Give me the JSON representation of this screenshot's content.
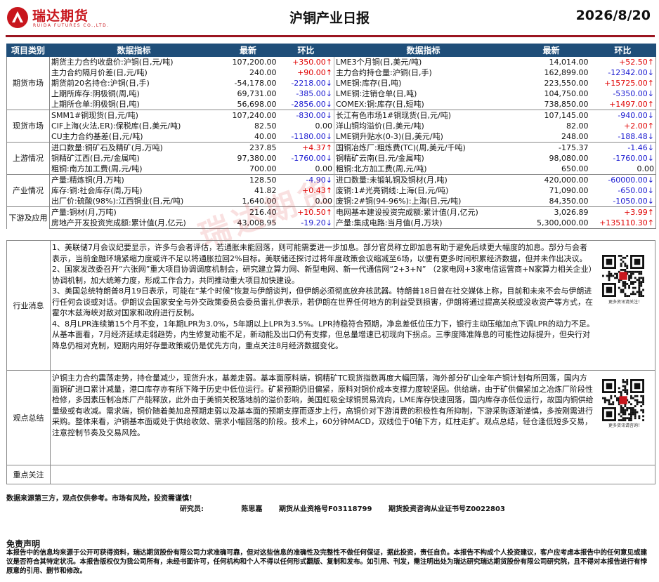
{
  "header": {
    "logo_cn": "瑞达期货",
    "logo_en": "RUIDA FUTURES CO.,LTD.",
    "title": "沪铜产业日报",
    "date": "2026/8/20"
  },
  "table": {
    "headers": [
      "项目类别",
      "数据指标",
      "最新",
      "环比",
      "数据指标",
      "最新",
      "环比"
    ],
    "groups": [
      {
        "name": "期货市场",
        "rows": [
          [
            "期货主力合约收盘价:沪铜(日,元/吨)",
            "107,200.00",
            "+350.00↑",
            "LME3个月铜(日,美元/吨)",
            "14,014.00",
            "+52.50↑"
          ],
          [
            "主力合约隔月价差(日,元/吨)",
            "240.00",
            "+90.00↑",
            " 主力合约持仓量:沪铜(日,手)",
            "162,899.00",
            "-12342.00↓"
          ],
          [
            "期货前20名持仓:沪铜(日,手)",
            "-54,178.00",
            "-2218.00↓",
            "LME铜:库存(日,吨)",
            "223,550.00",
            "+15725.00↑"
          ],
          [
            "上期所库存:阴极铜(周,吨)",
            "69,731.00",
            "-385.00↓",
            "LME铜:注销仓单(日,吨)",
            "104,750.00",
            "-5350.00↓"
          ],
          [
            "上期所仓单:阴极铜(日,吨)",
            "56,698.00",
            "-2856.00↓",
            "COMEX:铜:库存(日,短吨)",
            "738,850.00",
            "+1497.00↑"
          ]
        ]
      },
      {
        "name": "现货市场",
        "rows": [
          [
            "SMM1#铜现货(日,元/吨)",
            "107,240.00",
            "-830.00↓",
            "长江有色市场1#铜现货(日,元/吨)",
            "107,145.00",
            "-940.00↓"
          ],
          [
            "CIF上海(火法,ER):保税库(日,美元/吨)",
            "82.50",
            "0.00",
            "洋山铜均溢价(日,美元/吨)",
            "82.00",
            "+2.00↑"
          ],
          [
            "CU主力合约基差(日,元/吨)",
            "40.00",
            "-1180.00↓",
            "LME铜升贴水(0-3)(日,美元/吨)",
            "248.00",
            "-188.48↓"
          ]
        ]
      },
      {
        "name": "上游情况",
        "rows": [
          [
            "进口数量:铜矿石及精矿(月,万吨)",
            "237.85",
            "+4.37↑",
            "国铜冶炼厂:粗炼费(TC)(周,美元/千吨)",
            "-175.37",
            "-1.46↓"
          ],
          [
            "铜精矿江西(日,元/金属吨)",
            "97,380.00",
            "-1760.00↓",
            "铜精矿云南(日,元/金属吨)",
            "98,080.00",
            "-1760.00↓"
          ],
          [
            "粗铜:南方加工费(周,元/吨)",
            "700.00",
            "0.00",
            "粗铜:北方加工费(周,元/吨)",
            "650.00",
            "0.00"
          ]
        ]
      },
      {
        "name": "产业情况",
        "rows": [
          [
            "产量:精炼铜(月,万吨)",
            "128.50",
            "-4.90↓",
            "进口数量:未锻轧铜及铜材(月,吨)",
            "420,000.00",
            "-60000.00↓"
          ],
          [
            "库存:铜:社会库存(周,万吨)",
            "41.82",
            "+0.43↑",
            "废铜:1#光亮铜线:上海(日,元/吨)",
            "71,090.00",
            "-650.00↓"
          ],
          [
            "出厂价:硫酸(98%):江西铜业(日,元/吨)",
            "1,640.00",
            "0.00",
            "废铜:2#铜(94-96%):上海(日,元/吨)",
            "84,350.00",
            "-1050.00↓"
          ]
        ]
      },
      {
        "name": "下游及应用",
        "rows": [
          [
            "产量:铜材(月,万吨)",
            "216.40",
            "+10.50↑",
            "电网基本建设投资完成额:累计值(月,亿元)",
            "3,026.89",
            "+3.99↑"
          ],
          [
            "房地产开发投资完成额:累计值(月,亿元)",
            "43,008.95",
            "-19.20↓",
            "产量:集成电路:当月值(月,万块)",
            "5,300,000.00",
            "+135110.30↑"
          ]
        ]
      }
    ]
  },
  "news": {
    "label": "行业消息",
    "items": [
      "1、美联储7月会议纪要显示，许多与会者评估，若通胀未能回落，则可能需要进一步加息。部分官员称立即加息有助于避免后续更大幅度的加息。部分与会者表示，当前金融环境紧缩力度或许不足以将通胀拉回2%目标。美联储还探讨过将年度政策会议缩减至6场，以便有更多时间积累经济数据，但并未作出决议。",
      "2、国家发改委召开“六张网”重大项目协调调度机制会，研究建立算力网、新型电网、新一代通信网“2+3+N” （2家电网+3家电信运营商+N家算力相关企业）协调机制，加大统筹力度，形成工作合力，共同推动重大项目加快建设。",
      "3、美国总统特朗普8月19日表示，可能在“某个时候”恢复与伊朗谈判，但伊朗必须彻底放弃核武器。特朗普18日曾在社交媒体上称，目前和未来不会与伊朗进行任何会谈或对话。伊朗议会国家安全与外交政策委员会委员雷扎伊表示，若伊朗在世界任何地方的利益受到损害，伊朗将通过提高关税或没收资产等方式，在霍尔木兹海峡对敌对国家和政府进行反制。",
      "4、8月LPR连续第15个月不变，1年期LPR为3.0%，5年期以上LPR为3.5%。LPR持稳符合预期，净息差低位压力下，银行主动压缩加点下调LPR的动力不足。从基本面看，7月经济延续走弱趋势，内生修复动能不足，新动能及出口仍有支撑，但总量增速已初现向下拐点。三季度降准降息的可能性边际提升，但央行对降息仍相对克制，短期内用好存量政策或仍是优先方向，重点关注8月经济数据变化。"
    ],
    "qr_caption": "更多资讯请关注！"
  },
  "view": {
    "label": "观点总结",
    "text": "沪铜主力合约震荡走势，持仓量减少，现货升水，基差走弱。基本面原料端，铜精矿TC现货指数再度大幅回落，海外部分矿山全年产铜计划有所回落，国内方面铜矿进口累计减量，港口库存亦有所下降于历史中低位运行。矿紧预期仍旧偏紧，原料对铜价成本支撑力度较坚固。供给端，由于矿供偏紧加之冶炼厂阶段性检修，多因素压制冶炼厂产能释放，此外由于美铜关税落地前的溢价影响，美国虹吸全球铜贸易流向，LME库存快速回落，国内库存亦低位运行，故国内铜供给量级或有收减。需求端，铜价随着美加息预期走弱以及基本面的预期支撑而逐步上行，高铜价对下游消费的积极性有所抑制，下游采购逐渐谨慎，多按刚需进行采购。整体来看，沪铜基本面或处于供给收敛、需求小幅回落的阶段。技术上，60分钟MACD，双线位于0轴下方，红柱走扩。观点总结，轻仓逢低短多交易，注意控制节奏及交易风险。",
    "qr_caption": "更多资讯请咨询！"
  },
  "focus": {
    "label": "重点关注",
    "text": ""
  },
  "footer": {
    "source": "数据来源第三方，观点仅供参考。市场有风险，投资需谨慎！",
    "researcher_label": "研究员:",
    "researcher_name": "陈思嘉",
    "cert1": "期货从业资格号F03118799",
    "cert2": "期货投资咨询从业证书号Z0022803",
    "disclaimer_title": "免责声明",
    "disclaimer": "本报告中的信息均来源于公开可获得资料，瑞达期货股份有限公司力求准确可靠，但对这些信息的准确性及完整性不做任何保证，据此投资，责任自负。本报告不构成个人投资建议，客户应考虑本报告中的任何意见或建议是否符合其特定状况。本报告版权仅为我公司所有，未经书面许可，任何机构和个人不得以任何形式翻版、复制和发布。如引用、刊发，需注明出处为瑞达研究瑞达期货股份有限公司研究院，且不得对本报告进行有悖原意的引用、删节和修改。",
    "watermark": "瑞达期货"
  },
  "colors": {
    "brand_red": "#c8161d",
    "header_blue": "#1f4e79",
    "up": "#e00000",
    "down": "#1a1ad0"
  }
}
